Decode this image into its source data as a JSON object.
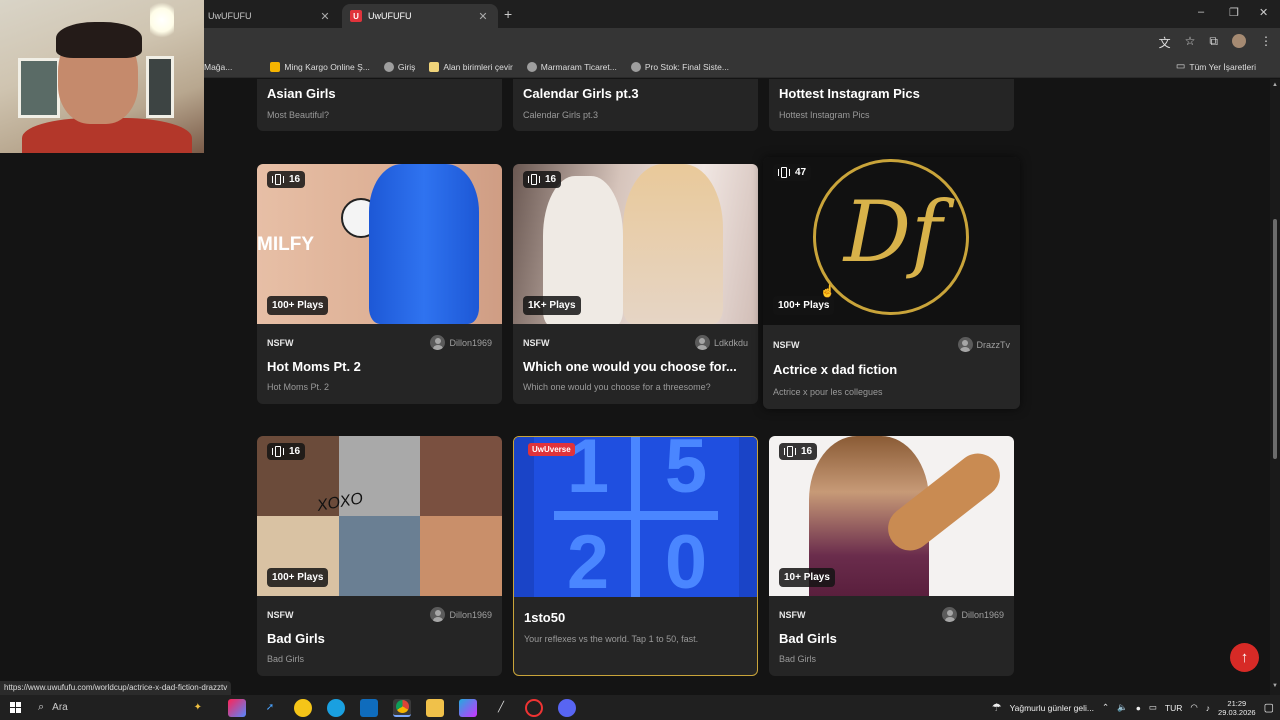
{
  "browser": {
    "tabs": [
      {
        "label": "UwUFUFU",
        "close": "✕"
      },
      {
        "label": "UwUFUFU",
        "close": "✕",
        "favicon": "U"
      }
    ],
    "new_tab": "+",
    "window_controls": {
      "minimize": "–",
      "restore": "❐",
      "close": "✕"
    },
    "bookmarks": [
      {
        "label": "Mağa...",
        "color": "#4a4a4a"
      },
      {
        "label": "Ming Kargo Online Ş...",
        "color": "#f5b400"
      },
      {
        "label": "Giriş",
        "color": "#9e9e9e"
      },
      {
        "label": "Alan birimleri çevir",
        "color": "#f0d47a"
      },
      {
        "label": "Marmaram Ticaret...",
        "color": "#9e9e9e"
      },
      {
        "label": "Pro Stok: Final Siste...",
        "color": "#9e9e9e"
      }
    ],
    "all_bookmarks": "Tüm Yer İşaretleri"
  },
  "top_row": [
    {
      "title": "Asian Girls",
      "desc": "Most Beautiful?"
    },
    {
      "title": "Calendar Girls pt.3",
      "desc": "Calendar Girls pt.3"
    },
    {
      "title": "Hottest Instagram Pics",
      "desc": "Hottest Instagram Pics"
    }
  ],
  "middle_row": [
    {
      "count": "16",
      "plays": "100+ Plays",
      "tag": "NSFW",
      "author": "Dillon1969",
      "title": "Hot Moms Pt. 2",
      "desc": "Hot Moms Pt. 2",
      "thumb_text": "MILFY"
    },
    {
      "count": "16",
      "plays": "1K+ Plays",
      "tag": "NSFW",
      "author": "Ldkdkdu",
      "title": "Which one would you choose for...",
      "desc": "Which one would you choose for a threesome?"
    },
    {
      "count": "47",
      "plays": "100+ Plays",
      "tag": "NSFW",
      "author": "DrazzTv",
      "title": "Actrice x dad fiction",
      "desc": "Actrice x pour les collegues",
      "logo_text": "Df"
    }
  ],
  "bottom_row": [
    {
      "count": "16",
      "plays": "100+ Plays",
      "tag": "NSFW",
      "author": "Dillon1969",
      "title": "Bad Girls",
      "desc": "Bad Girls",
      "thumb_text": "XOXO"
    },
    {
      "badge": "UwUverse",
      "title": "1sto50",
      "desc": "Your reflexes vs the world. Tap 1 to 50, fast.",
      "digits": [
        "1",
        "5",
        "2",
        "0"
      ]
    },
    {
      "count": "16",
      "plays": "10+ Plays",
      "tag": "NSFW",
      "author": "Dillon1969",
      "title": "Bad Girls",
      "desc": "Bad Girls"
    }
  ],
  "status_url": "https://www.uwufufu.com/worldcup/actrice-x-dad-fiction-drazztv",
  "scroll_top_icon": "↑",
  "taskbar": {
    "search_placeholder": "Ara",
    "weather": "Yağmurlu günler geli...",
    "lang": "TUR",
    "time": "21:29",
    "date": "29.03.2026"
  }
}
